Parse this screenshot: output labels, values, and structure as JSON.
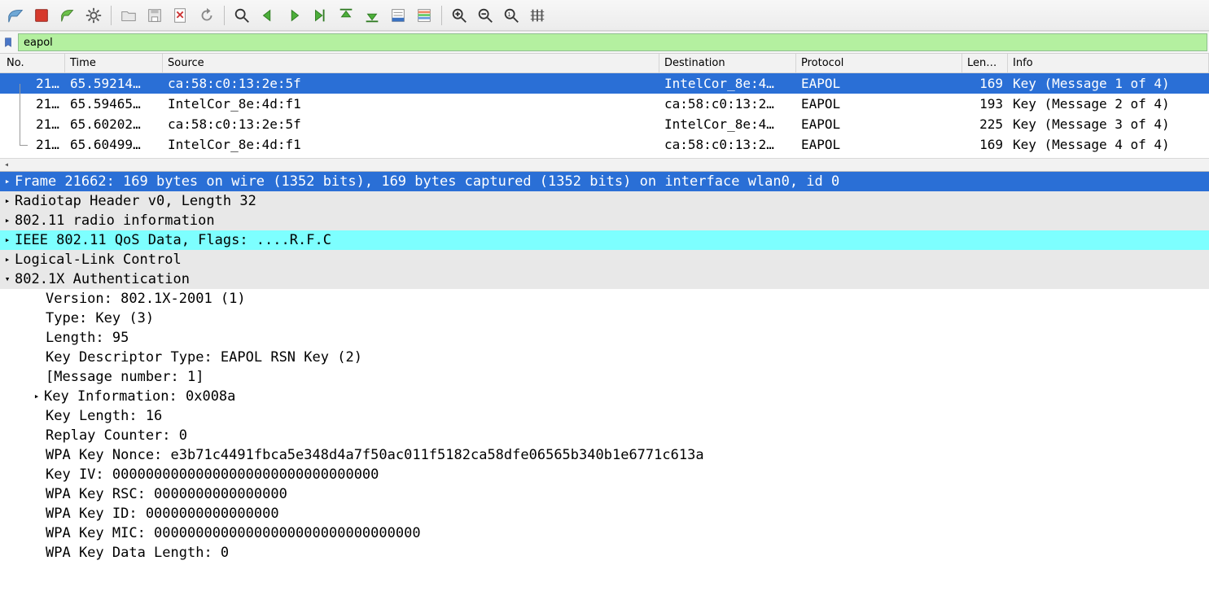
{
  "filter": {
    "value": "eapol"
  },
  "columns": {
    "no": "No.",
    "time": "Time",
    "src": "Source",
    "dst": "Destination",
    "proto": "Protocol",
    "len": "Length",
    "info": "Info"
  },
  "packets": [
    {
      "no": "21…",
      "time": "65.59214…",
      "src": "ca:58:c0:13:2e:5f",
      "dst": "IntelCor_8e:4…",
      "proto": "EAPOL",
      "len": "169",
      "info": "Key (Message 1 of 4)",
      "selected": true,
      "first": true
    },
    {
      "no": "21…",
      "time": "65.59465…",
      "src": "IntelCor_8e:4d:f1",
      "dst": "ca:58:c0:13:2…",
      "proto": "EAPOL",
      "len": "193",
      "info": "Key (Message 2 of 4)"
    },
    {
      "no": "21…",
      "time": "65.60202…",
      "src": "ca:58:c0:13:2e:5f",
      "dst": "IntelCor_8e:4…",
      "proto": "EAPOL",
      "len": "225",
      "info": "Key (Message 3 of 4)"
    },
    {
      "no": "21…",
      "time": "65.60499…",
      "src": "IntelCor_8e:4d:f1",
      "dst": "ca:58:c0:13:2…",
      "proto": "EAPOL",
      "len": "169",
      "info": "Key (Message 4 of 4)",
      "last": true
    }
  ],
  "tree": {
    "frame": "Frame 21662: 169 bytes on wire (1352 bits), 169 bytes captured (1352 bits) on interface wlan0, id 0",
    "radiotap": "Radiotap Header v0, Length 32",
    "radio": "802.11 radio information",
    "qos": "IEEE 802.11 QoS Data, Flags: ....R.F.C",
    "llc": "Logical-Link Control",
    "eapol": "802.1X Authentication",
    "auth": {
      "version": "Version: 802.1X-2001 (1)",
      "type": "Type: Key (3)",
      "length": "Length: 95",
      "kdt": "Key Descriptor Type: EAPOL RSN Key (2)",
      "msgnum": "[Message number: 1]",
      "keyinfo": "Key Information: 0x008a",
      "keylen": "Key Length: 16",
      "replay": "Replay Counter: 0",
      "nonce": "WPA Key Nonce: e3b71c4491fbca5e348d4a7f50ac011f5182ca58dfe06565b340b1e6771c613a",
      "iv": "Key IV: 00000000000000000000000000000000",
      "rsc": "WPA Key RSC: 0000000000000000",
      "id": "WPA Key ID: 0000000000000000",
      "mic": "WPA Key MIC: 00000000000000000000000000000000",
      "datalen": "WPA Key Data Length: 0"
    }
  },
  "icons": {
    "fin": "wireshark-fin-icon",
    "stop": "stop-icon",
    "restart": "restart-icon",
    "options": "options-gear-icon",
    "open": "open-icon",
    "save": "save-icon",
    "close": "close-file-icon",
    "reload": "reload-icon",
    "find": "find-icon",
    "back": "go-back-icon",
    "fwd": "go-forward-icon",
    "jump": "go-to-packet-icon",
    "first": "go-first-icon",
    "last": "go-last-icon",
    "auto": "auto-scroll-icon",
    "colorize": "colorize-icon",
    "zin": "zoom-in-icon",
    "zout": "zoom-out-icon",
    "z1": "zoom-reset-icon",
    "cols": "resize-columns-icon",
    "bookmark": "filter-bookmark-icon"
  }
}
